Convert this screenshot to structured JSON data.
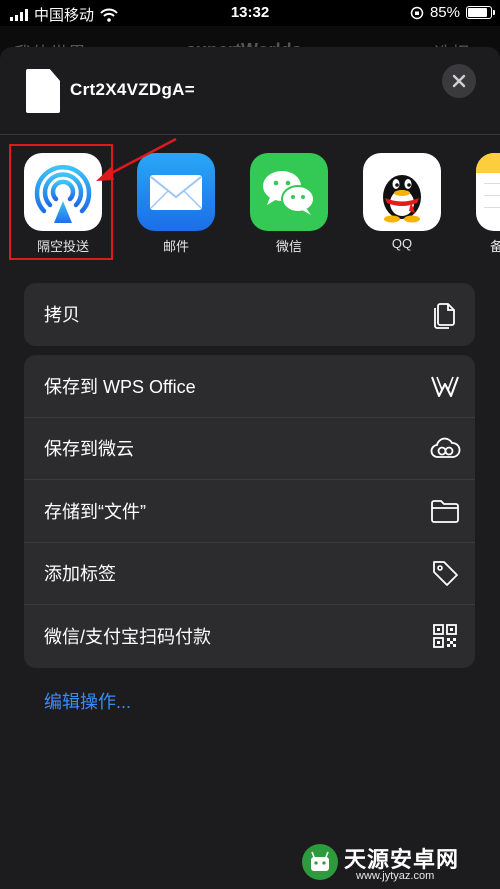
{
  "status_bar": {
    "carrier": "中国移动",
    "time": "13:32",
    "battery_percent": "85%",
    "battery_level": 0.85
  },
  "background_app": {
    "back_label": "我的世界",
    "title": "supertWorlds",
    "right_label": "选择"
  },
  "sheet": {
    "file_name": "Crt2X4VZDgA=",
    "apps": [
      {
        "label": "隔空投送",
        "icon": "airdrop-icon"
      },
      {
        "label": "邮件",
        "icon": "mail-icon"
      },
      {
        "label": "微信",
        "icon": "wechat-icon"
      },
      {
        "label": "QQ",
        "icon": "qq-icon"
      },
      {
        "label": "备",
        "icon": "notes-icon"
      }
    ],
    "copy_group": [
      {
        "label": "拷贝",
        "icon": "copy-icon"
      }
    ],
    "action_group": [
      {
        "label": "保存到 WPS Office",
        "icon": "wps-icon"
      },
      {
        "label": "保存到微云",
        "icon": "weiyun-cloud-icon"
      },
      {
        "label": "存储到“文件”",
        "icon": "folder-icon"
      },
      {
        "label": "添加标签",
        "icon": "tag-icon"
      },
      {
        "label": "微信/支付宝扫码付款",
        "icon": "qr-code-icon"
      }
    ],
    "edit_actions": "编辑操作..."
  },
  "watermark": {
    "name": "天源安卓网",
    "url": "www.jytyaz.com"
  },
  "colors": {
    "sheet_bg": "#1c1c1e",
    "cell_bg": "#2c2c2e",
    "link_blue": "#3b8bf6",
    "highlight_red": "#e0191d"
  }
}
